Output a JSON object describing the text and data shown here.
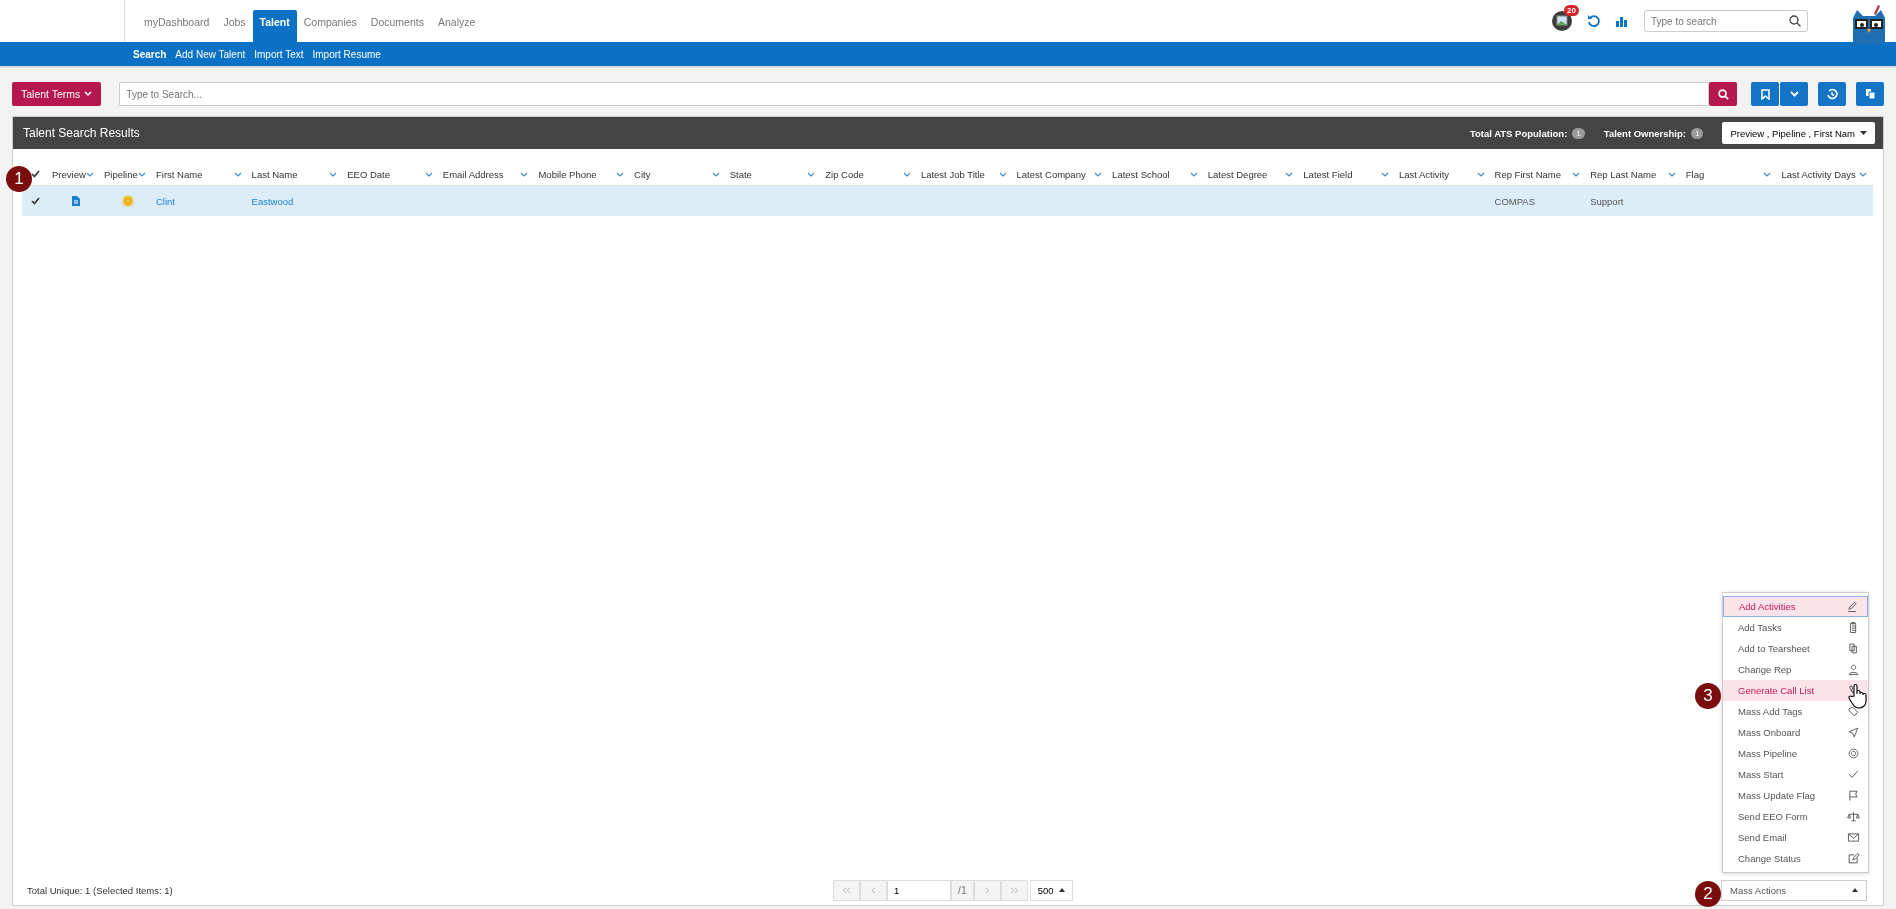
{
  "nav": {
    "tabs": [
      {
        "label": "myDashboard",
        "selected": false
      },
      {
        "label": "Jobs",
        "selected": false
      },
      {
        "label": "Talent",
        "selected": true
      },
      {
        "label": "Companies",
        "selected": false
      },
      {
        "label": "Documents",
        "selected": false
      },
      {
        "label": "Analyze",
        "selected": false
      }
    ]
  },
  "subnav": {
    "items": [
      {
        "label": "Search",
        "selected": true
      },
      {
        "label": "Add New Talent",
        "selected": false
      },
      {
        "label": "Import Text",
        "selected": false
      },
      {
        "label": "Import Resume",
        "selected": false
      }
    ]
  },
  "notifications": {
    "count": "20"
  },
  "header_search": {
    "placeholder": "Type to search"
  },
  "toolbar": {
    "terms_button": "Talent Terms",
    "search": {
      "placeholder": "Type to Search..."
    }
  },
  "results": {
    "title": "Talent Search Results",
    "stats": [
      {
        "label": "Total ATS Population:",
        "count": "1"
      },
      {
        "label": "Talent Ownership:",
        "count": "1"
      }
    ],
    "columns_select": "Preview , Pipeline , First Nam",
    "all_checked": true,
    "columns": [
      "Preview",
      "Pipeline",
      "First Name",
      "Last Name",
      "EEO Date",
      "Email Address",
      "Mobile Phone",
      "City",
      "State",
      "Zip Code",
      "Latest Job Title",
      "Latest Company",
      "Latest School",
      "Latest Degree",
      "Latest Field",
      "Last Activity",
      "Rep First Name",
      "Rep Last Name",
      "Flag",
      "Last Activity Days"
    ],
    "rows": [
      {
        "checked": true,
        "selected": true,
        "first_name": "Clint",
        "last_name": "Eastwood",
        "rep_first_name": "COMPAS",
        "rep_last_name": "Support"
      }
    ]
  },
  "footer": {
    "summary": "Total Unique: 1 (Selected Items: 1)",
    "page": "1",
    "page_total": "/1",
    "page_size": "500"
  },
  "mass_actions": {
    "label": "Mass Actions",
    "expanded": true,
    "items": [
      {
        "label": "Add Activities",
        "highlighted": true,
        "focused": true
      },
      {
        "label": "Add Tasks",
        "highlighted": false,
        "focused": false
      },
      {
        "label": "Add to Tearsheet",
        "highlighted": false,
        "focused": false
      },
      {
        "label": "Change Rep",
        "highlighted": false,
        "focused": false
      },
      {
        "label": "Generate Call List",
        "highlighted": true,
        "focused": false
      },
      {
        "label": "Mass Add Tags",
        "highlighted": false,
        "focused": false
      },
      {
        "label": "Mass Onboard",
        "highlighted": false,
        "focused": false
      },
      {
        "label": "Mass Pipeline",
        "highlighted": false,
        "focused": false
      },
      {
        "label": "Mass Start",
        "highlighted": false,
        "focused": false
      },
      {
        "label": "Mass Update Flag",
        "highlighted": false,
        "focused": false
      },
      {
        "label": "Send EEO Form",
        "highlighted": false,
        "focused": false
      },
      {
        "label": "Send Email",
        "highlighted": false,
        "focused": false
      },
      {
        "label": "Change Status",
        "highlighted": false,
        "focused": false
      }
    ]
  },
  "markers": [
    {
      "label": "1"
    },
    {
      "label": "2"
    },
    {
      "label": "3"
    }
  ]
}
